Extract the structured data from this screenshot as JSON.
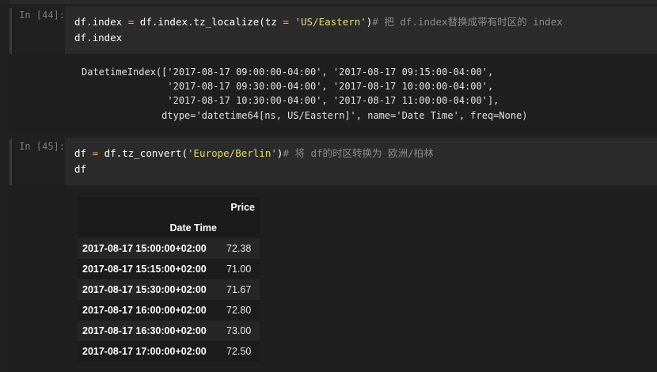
{
  "cells": [
    {
      "prompt": "In [44]:",
      "code_line1_a": "df.index ",
      "code_line1_op1": "=",
      "code_line1_b": " df.index.tz_localize(tz ",
      "code_line1_op2": "=",
      "code_line1_sp": " ",
      "code_line1_str": "'US/Eastern'",
      "code_line1_c": ")",
      "code_line1_comment": "# 把 df.index替换成带有时区的 index",
      "code_line2": "df.index",
      "output_lines": [
        "DatetimeIndex(['2017-08-17 09:00:00-04:00', '2017-08-17 09:15:00-04:00',",
        "               '2017-08-17 09:30:00-04:00', '2017-08-17 10:00:00-04:00',",
        "               '2017-08-17 10:30:00-04:00', '2017-08-17 11:00:00-04:00'],",
        "              dtype='datetime64[ns, US/Eastern]', name='Date Time', freq=None)"
      ]
    },
    {
      "prompt": "In [45]:",
      "code_line1_a": "df ",
      "code_line1_op1": "=",
      "code_line1_b": " df.tz_convert(",
      "code_line1_str": "'Europe/Berlin'",
      "code_line1_c": ")",
      "code_line1_comment": "# 将 df的时区转换为 欧洲/柏林",
      "code_line2": "df"
    }
  ],
  "table": {
    "column_header": "Price",
    "index_name": "Date Time",
    "rows": [
      {
        "index": "2017-08-17 15:00:00+02:00",
        "price": "72.38"
      },
      {
        "index": "2017-08-17 15:15:00+02:00",
        "price": "71.00"
      },
      {
        "index": "2017-08-17 15:30:00+02:00",
        "price": "71.67"
      },
      {
        "index": "2017-08-17 16:00:00+02:00",
        "price": "72.80"
      },
      {
        "index": "2017-08-17 16:30:00+02:00",
        "price": "73.00"
      },
      {
        "index": "2017-08-17 17:00:00+02:00",
        "price": "72.50"
      }
    ]
  }
}
